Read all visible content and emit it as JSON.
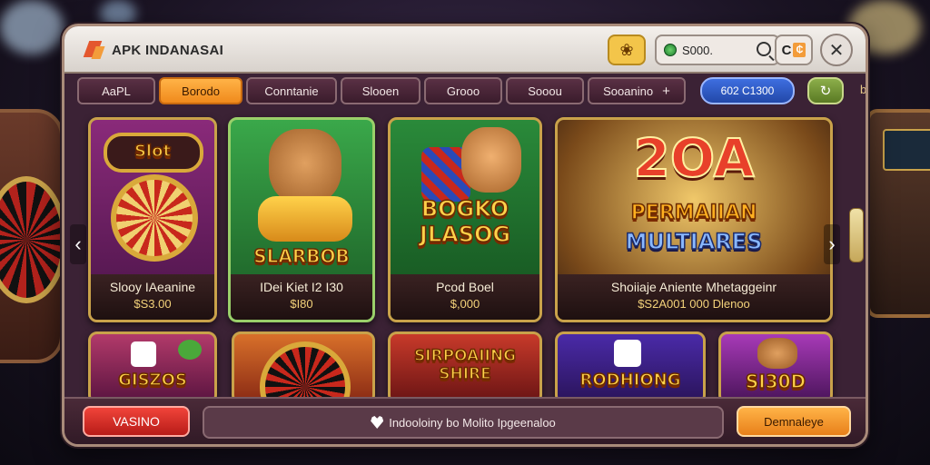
{
  "app": {
    "title": "APK INDANASAI"
  },
  "topbar": {
    "balance": "S000.",
    "c_label": "C"
  },
  "tabs": [
    {
      "label": "AaPL",
      "active": false
    },
    {
      "label": "Borodo",
      "active": true
    },
    {
      "label": "Conntanie",
      "active": false
    },
    {
      "label": "Slooen",
      "active": false
    },
    {
      "label": "Grooo",
      "active": false
    },
    {
      "label": "Sooou",
      "active": false
    },
    {
      "label": "Sooanino",
      "active": false
    }
  ],
  "tab_extra": {
    "pill": "602  C1300",
    "cut": "bo"
  },
  "games_top": [
    {
      "art": "Slot",
      "name": "Slooy IAeanine",
      "price": "$S3.00"
    },
    {
      "art": "SLARBOB",
      "name": "IDei Kiet I2 I30",
      "price": "$I80"
    },
    {
      "art": "BOGKO JLASOG",
      "name": "Pcod Boel",
      "price": "$,000"
    },
    {
      "art_line1": "2OA",
      "art_line2": "PERMAIIAN",
      "art_line3": "MULTIARES",
      "name": "Shoiiaje Aniente Mhetaggeinr",
      "price": "$S2A001 000 Dlenoo"
    }
  ],
  "games_bottom": [
    {
      "art": "GISZOS"
    },
    {
      "art": ""
    },
    {
      "art": "SIRPOAIING SHIRE"
    },
    {
      "art": "RODHIONG"
    },
    {
      "art": "SI30D"
    }
  ],
  "bottom": {
    "left_button": "VASINO",
    "message": "Indooloiny bo Molito Ipgeenaloo",
    "right_button": "Demnaleye"
  }
}
